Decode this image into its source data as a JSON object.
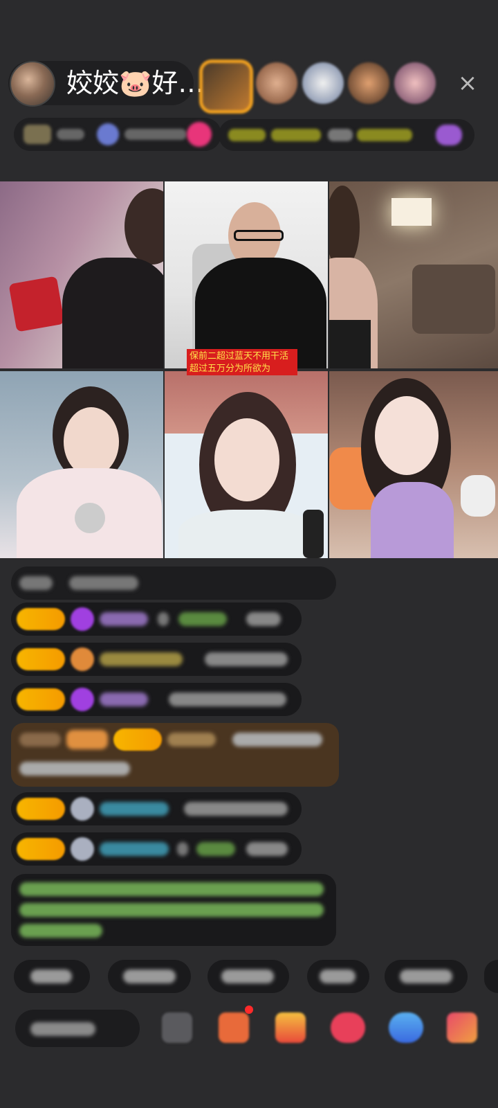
{
  "header": {
    "host_name": "姣姣🐷好…",
    "close_icon": "×"
  },
  "overlay": {
    "line1": "保前二超过蓝天不用干活",
    "line2": "超过五万分为所欲为"
  },
  "colors": {
    "background": "#2b2b2d",
    "badge": "#f7b500",
    "gift_message_bg": "#4a3520",
    "overlay_banner": "#d81e1e",
    "overlay_text": "#ffe14a",
    "system_text": "#8bd06a"
  },
  "icons": {
    "close": "close-icon",
    "avatar": "host-avatar",
    "gem": "diamond-icon"
  }
}
